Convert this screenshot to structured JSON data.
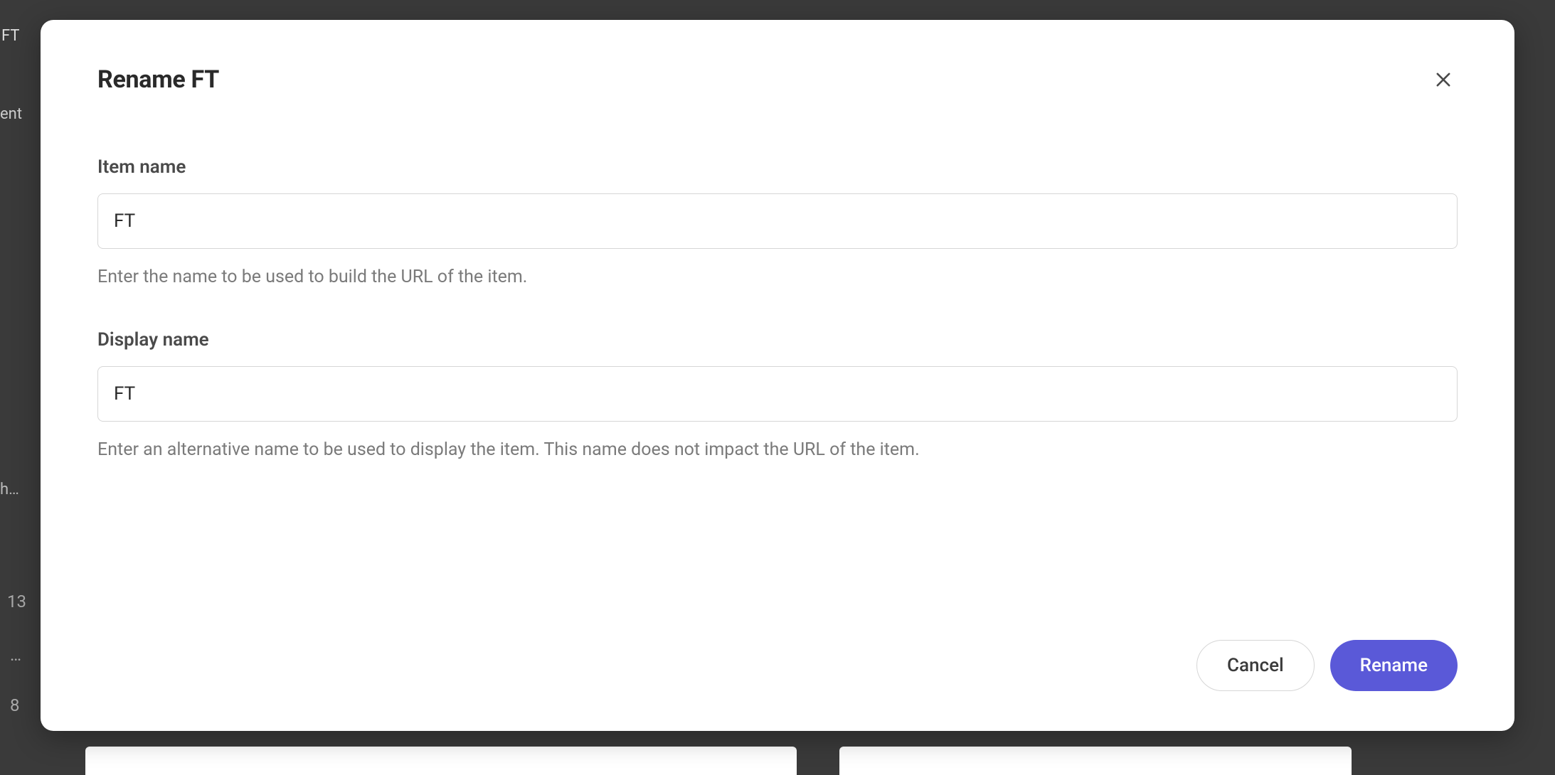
{
  "modal": {
    "title": "Rename FT",
    "fields": {
      "item_name": {
        "label": "Item name",
        "value": "FT",
        "help": "Enter the name to be used to build the URL of the item."
      },
      "display_name": {
        "label": "Display name",
        "value": "FT",
        "help": "Enter an alternative name to be used to display the item. This name does not impact the URL of the item."
      }
    },
    "buttons": {
      "cancel": "Cancel",
      "confirm": "Rename"
    }
  },
  "background": {
    "top_tab": "FT",
    "fragment_ent": "ent",
    "fragment_h": "h…",
    "number_13": "13",
    "fragment_dots": "…",
    "number_8": "8"
  }
}
